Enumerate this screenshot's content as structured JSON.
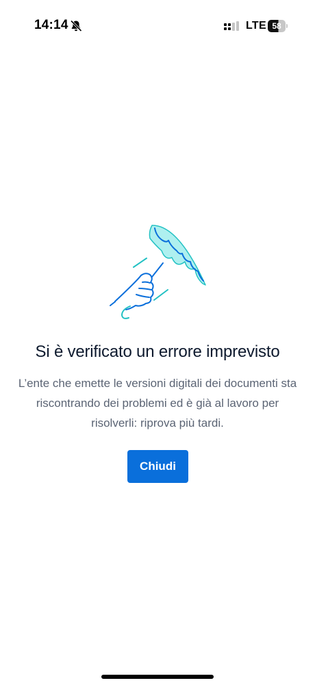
{
  "status_bar": {
    "time": "14:14",
    "silent_icon": "bell-slash-icon",
    "signal_icon": "cellular-signal-icon",
    "network": "LTE",
    "battery_level": "58"
  },
  "illustration": {
    "icon": "broken-umbrella-illustration",
    "colors": {
      "outline": "#0a6fdb",
      "fill": "#aef0ef",
      "accent": "#22c1c3"
    }
  },
  "error": {
    "title": "Si è verificato un errore imprevisto",
    "message": "L’ente che emette le versioni digitali dei documenti sta riscontrando dei problemi ed è già al lavoro per risolverli: riprova più tardi."
  },
  "actions": {
    "close_label": "Chiudi",
    "button_color": "#0a6fdb"
  }
}
